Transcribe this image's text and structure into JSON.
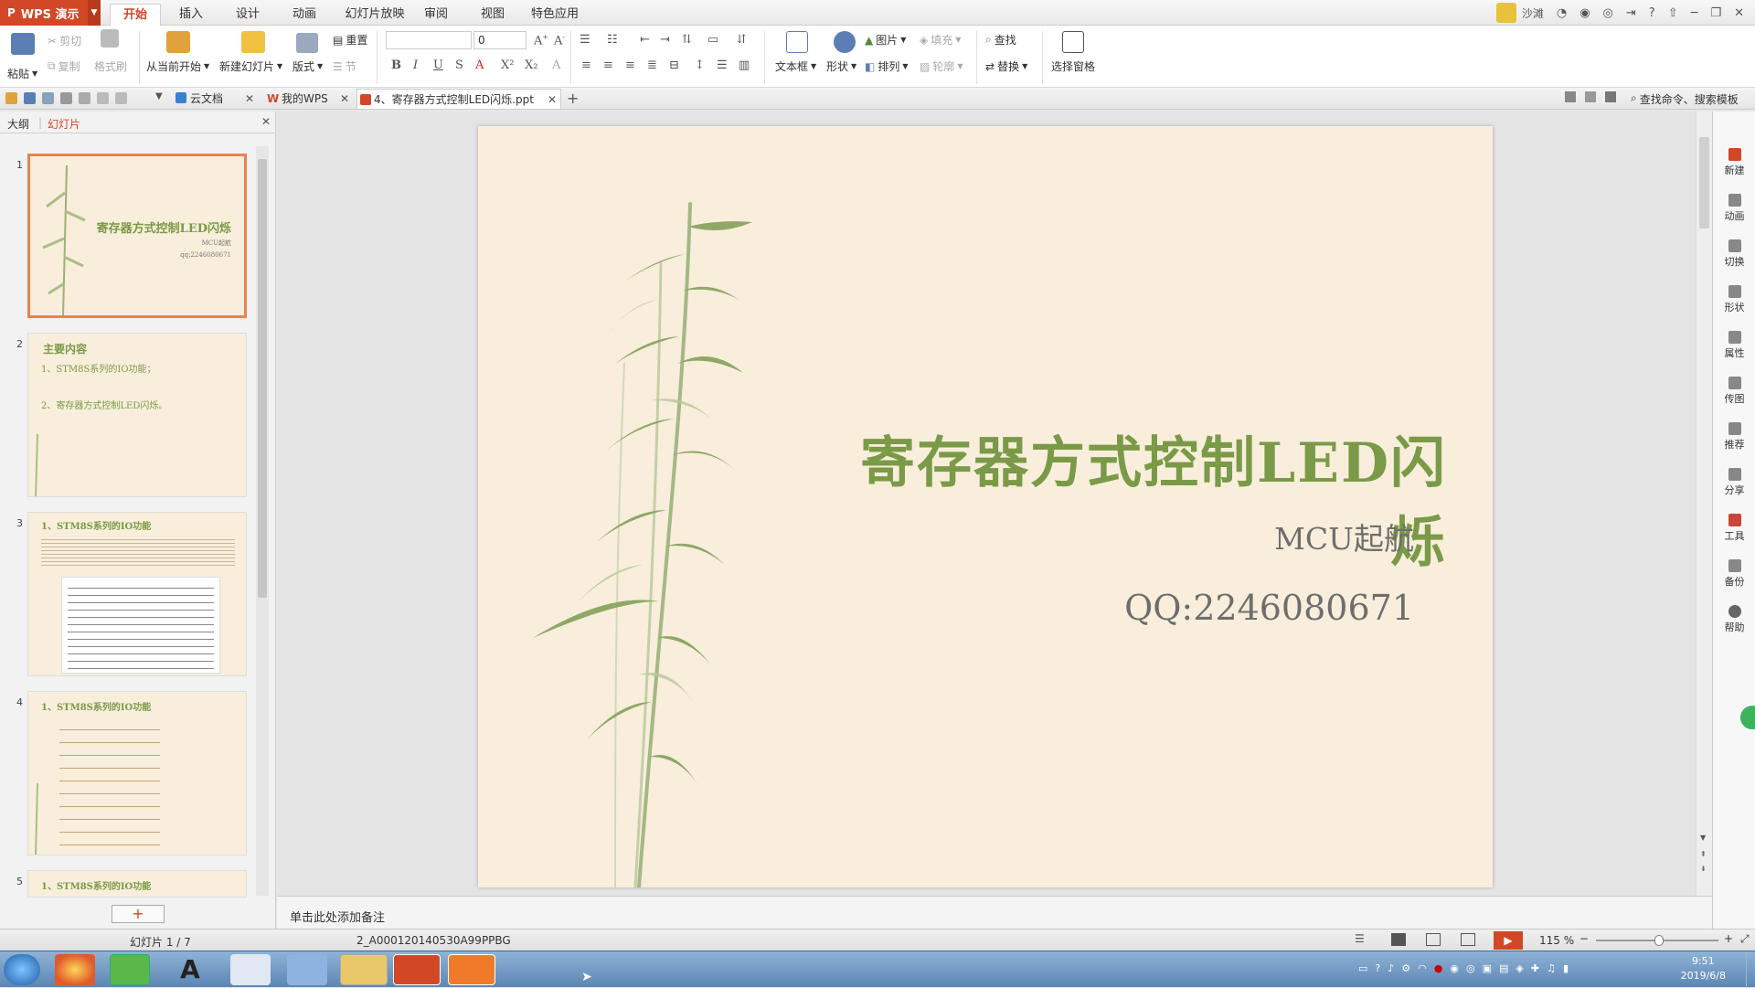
{
  "app": {
    "name": "WPS 演示",
    "user": "沙滩"
  },
  "menu_tabs": [
    {
      "label": "开始"
    },
    {
      "label": "插入"
    },
    {
      "label": "设计"
    },
    {
      "label": "动画"
    },
    {
      "label": "幻灯片放映"
    },
    {
      "label": "审阅"
    },
    {
      "label": "视图"
    },
    {
      "label": "特色应用"
    }
  ],
  "ribbon": {
    "paste": "粘贴",
    "cut": "剪切",
    "copy": "复制",
    "format_painter": "格式刷",
    "from_current": "从当前开始",
    "new_slide": "新建幻灯片",
    "layout": "版式",
    "reset": "重置",
    "section": "节",
    "font_size": "0",
    "textbox": "文本框",
    "shape": "形状",
    "picture": "图片",
    "fill": "填充",
    "arrange": "排列",
    "outline": "轮廓",
    "find": "查找",
    "replace": "替换",
    "select_pane": "选择窗格"
  },
  "doc_tabs": {
    "cloud": "云文档",
    "mywps": "我的WPS",
    "current": "4、寄存器方式控制LED闪烁.ppt",
    "search": "查找命令、搜索模板"
  },
  "left_panel": {
    "outline_tab": "大纲",
    "slides_tab": "幻灯片",
    "thumbs": {
      "t1": {
        "num": "1",
        "title": "寄存器方式控制LED闪烁",
        "sub": "MCU起航",
        "qq": "qq:2246080671"
      },
      "t2": {
        "num": "2",
        "title": "主要内容",
        "l1": "1、STM8S系列的IO功能；",
        "l2": "2、寄存器方式控制LED闪烁。"
      },
      "t3": {
        "num": "3",
        "title": "1、STM8S系列的IO功能"
      },
      "t4": {
        "num": "4",
        "title": "1、STM8S系列的IO功能"
      },
      "t5": {
        "num": "5",
        "title": "1、STM8S系列的IO功能"
      }
    }
  },
  "slide": {
    "title": "寄存器方式控制LED闪烁",
    "subtitle": "MCU起航",
    "qq": "QQ:2246080671"
  },
  "notes_placeholder": "单击此处添加备注",
  "right_bar": [
    "新建",
    "动画",
    "切换",
    "形状",
    "属性",
    "传图",
    "推荐",
    "分享",
    "工具",
    "备份",
    "帮助"
  ],
  "status": {
    "slide_count": "幻灯片 1 / 7",
    "template": "2_A000120140530A99PPBG",
    "zoom": "115 %"
  },
  "clock": {
    "time": "9:51",
    "date": "2019/6/8"
  },
  "colors": {
    "accent": "#d24726",
    "slide_bg": "#f8eedb",
    "title_green": "#7a9a48"
  }
}
